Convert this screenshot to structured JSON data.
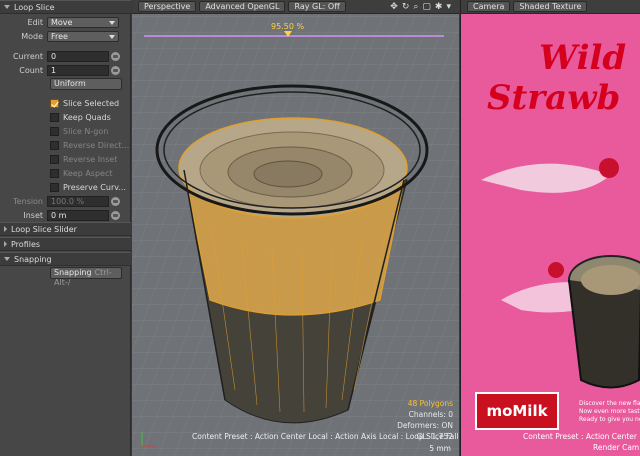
{
  "panel": {
    "loop_slice_title": "Loop Slice",
    "edit_label": "Edit",
    "edit_value": "Move",
    "mode_label": "Mode",
    "mode_value": "Free",
    "current_label": "Current",
    "current_value": "0",
    "count_label": "Count",
    "count_value": "1",
    "uniform_button": "Uniform",
    "slice_selected": "Slice Selected",
    "slice_selected_checked": true,
    "keep_quads": "Keep Quads",
    "slice_ngon": "Slice N-gon",
    "reverse_direction": "Reverse Direct...",
    "reverse_inset": "Reverse Inset",
    "keep_aspect": "Keep Aspect",
    "preserve_curvature": "Preserve Curv...",
    "tension_label": "Tension",
    "tension_value": "100.0 %",
    "inset_label": "Inset",
    "inset_value": "0 m",
    "loop_slice_slider_title": "Loop Slice Slider",
    "profiles_title": "Profiles",
    "snapping_title": "Snapping",
    "snapping_button": "Snapping",
    "snapping_shortcut": "Ctrl-Alt-/"
  },
  "viewport": {
    "tab_perspective": "Perspective",
    "tab_opengl": "Advanced OpenGL",
    "tab_raygl": "Ray GL: Off",
    "slider_value": "95.50 %",
    "polygons": "48 Polygons",
    "channels": "Channels: 0",
    "deformers": "Deformers: ON",
    "gl_info": "GL: 1,752",
    "units": "5 mm",
    "status": "Content Preset : Action Center Local : Action Axis Local : Loop Slice Falloff"
  },
  "render_view": {
    "tab_camera": "Camera",
    "tab_shaded": "Shaded Texture",
    "brand_line1": "Wild",
    "brand_line2": "Strawb",
    "logo_text": "moMilk",
    "promo_line1": "Discover the new flav",
    "promo_line2": "Now even more tasty",
    "promo_line3": "Ready to give you ne",
    "status": "Content Preset : Action Center Lo",
    "status2": "Render Cam"
  },
  "colors": {
    "panel_bg": "#474747",
    "viewport_bg": "#6f7377",
    "selection": "#e0a030",
    "render_bg": "#e85a9c",
    "brand_red": "#d4001e"
  }
}
